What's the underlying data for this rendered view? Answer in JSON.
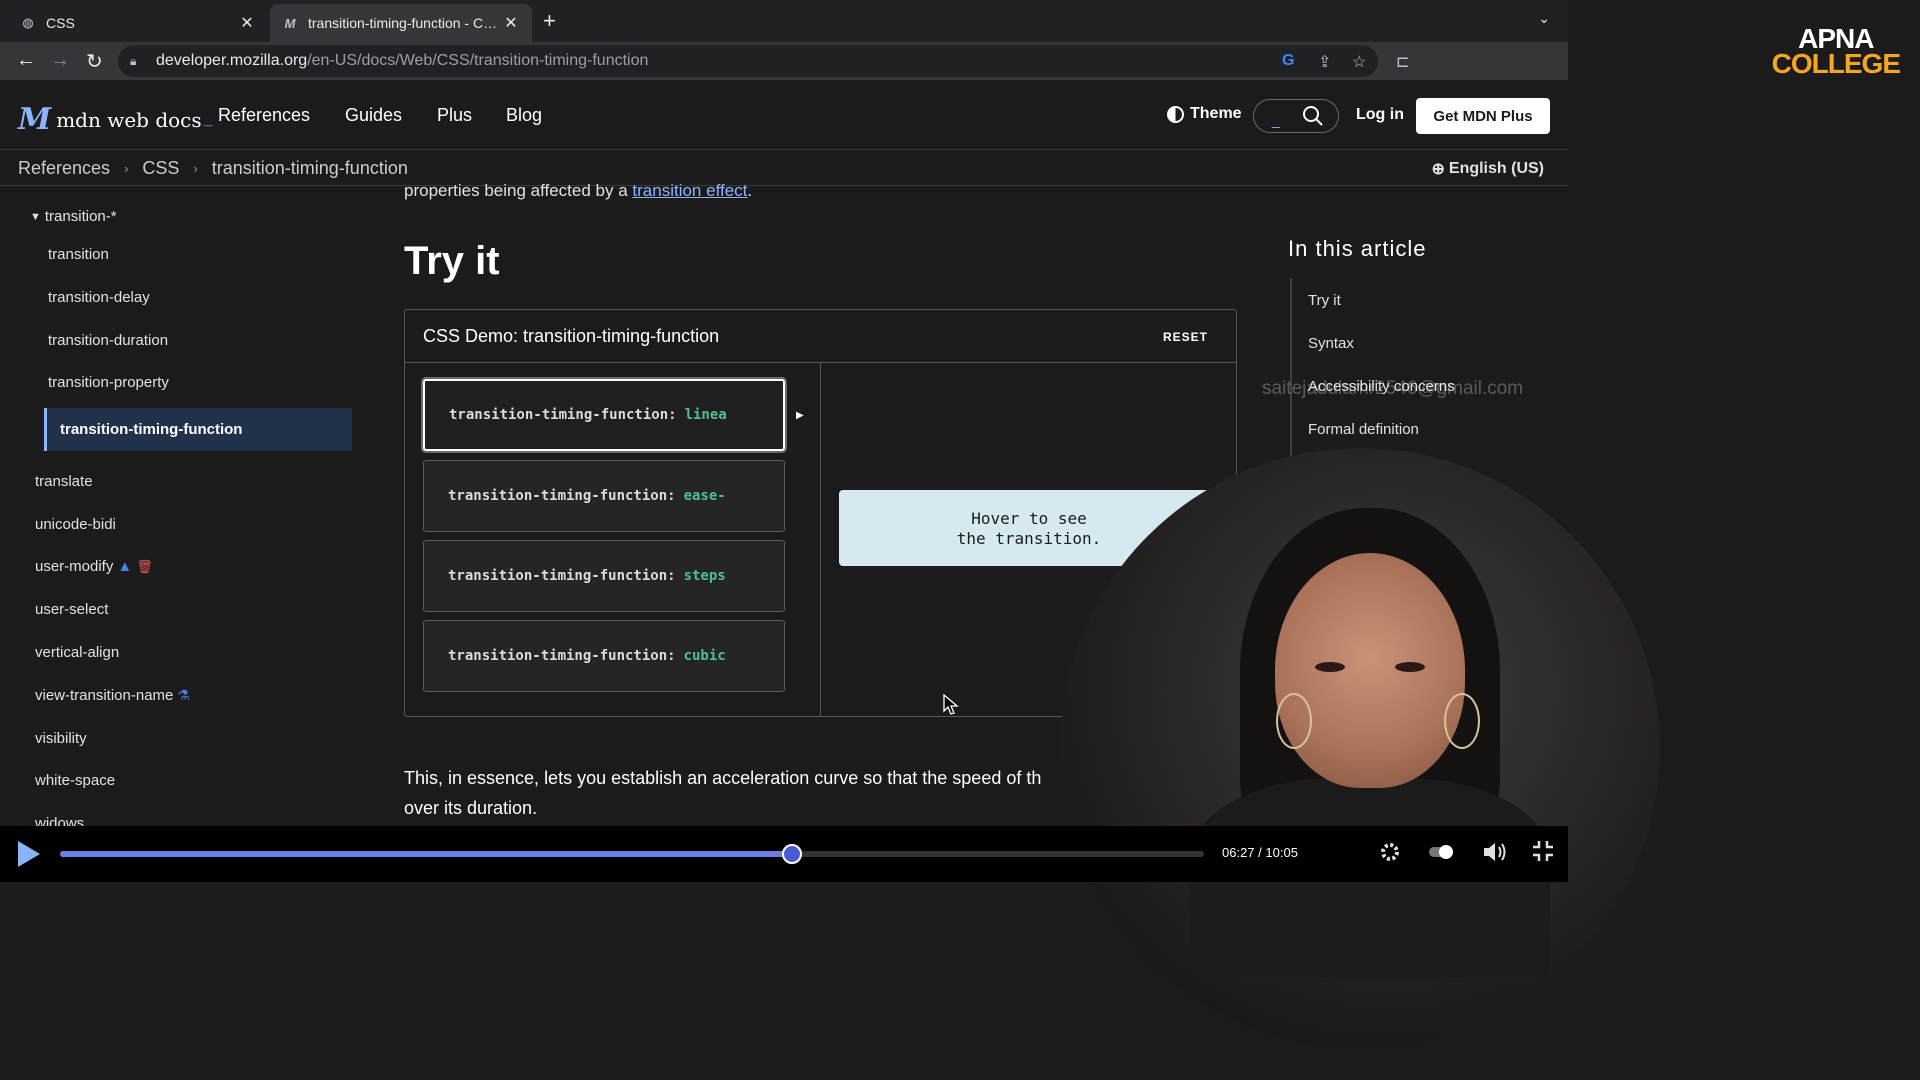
{
  "browser": {
    "tabs": [
      {
        "title": "CSS",
        "close": "✕"
      },
      {
        "title": "transition-timing-function - CSS: Cascading Style Sheets | MDN",
        "close": "✕"
      }
    ],
    "new_tab": "+",
    "url_host": "developer.mozilla.org",
    "url_path": "/en-US/docs/Web/CSS/transition-timing-function"
  },
  "channel_logo": {
    "line1": "APNA",
    "line2": "COLLEGE"
  },
  "mdn": {
    "logo_text": "mdn web docs",
    "nav": [
      "References",
      "Guides",
      "Plus",
      "Blog"
    ],
    "theme_label": "Theme",
    "login": "Log in",
    "get_plus": "Get MDN Plus",
    "search_kbd": "_"
  },
  "breadcrumb": [
    "References",
    "CSS",
    "transition-timing-function"
  ],
  "language": "English (US)",
  "sidebar": {
    "group": "transition-*",
    "children": [
      "transition",
      "transition-delay",
      "transition-duration",
      "transition-property"
    ],
    "active": "transition-timing-function",
    "items": [
      "translate",
      "unicode-bidi",
      "user-modify",
      "user-select",
      "vertical-align",
      "view-transition-name",
      "visibility",
      "white-space",
      "widows"
    ]
  },
  "main": {
    "intro_prefix": "properties being affected by a ",
    "intro_link": "transition effect",
    "intro_suffix": ".",
    "heading": "Try it",
    "demo_title": "CSS Demo: transition-timing-function",
    "reset": "RESET",
    "choices": [
      {
        "prop": "transition-timing-function:",
        "value": "linea"
      },
      {
        "prop": "transition-timing-function:",
        "value": "ease-"
      },
      {
        "prop": "transition-timing-function:",
        "value": "steps"
      },
      {
        "prop": "transition-timing-function:",
        "value": "cubic"
      }
    ],
    "hover_box_line1": "Hover to see",
    "hover_box_line2": "the transition.",
    "body_line1": "This, in essence, lets you establish an acceleration curve so that the speed of th",
    "body_line2": "over its duration."
  },
  "toc": {
    "title": "In this article",
    "items": [
      "Try it",
      "Syntax",
      "Accessibility concerns",
      "Formal definition"
    ]
  },
  "watermark": "saitejadulamr2546@gmail.com",
  "player": {
    "current_time": "06:27",
    "duration": "10:05",
    "progress": 0.64
  },
  "colors": {
    "accent": "#8cb4ff",
    "value_green": "#4fc08d",
    "progress": "#6b7fe6",
    "apna_orange": "#f5a623"
  }
}
